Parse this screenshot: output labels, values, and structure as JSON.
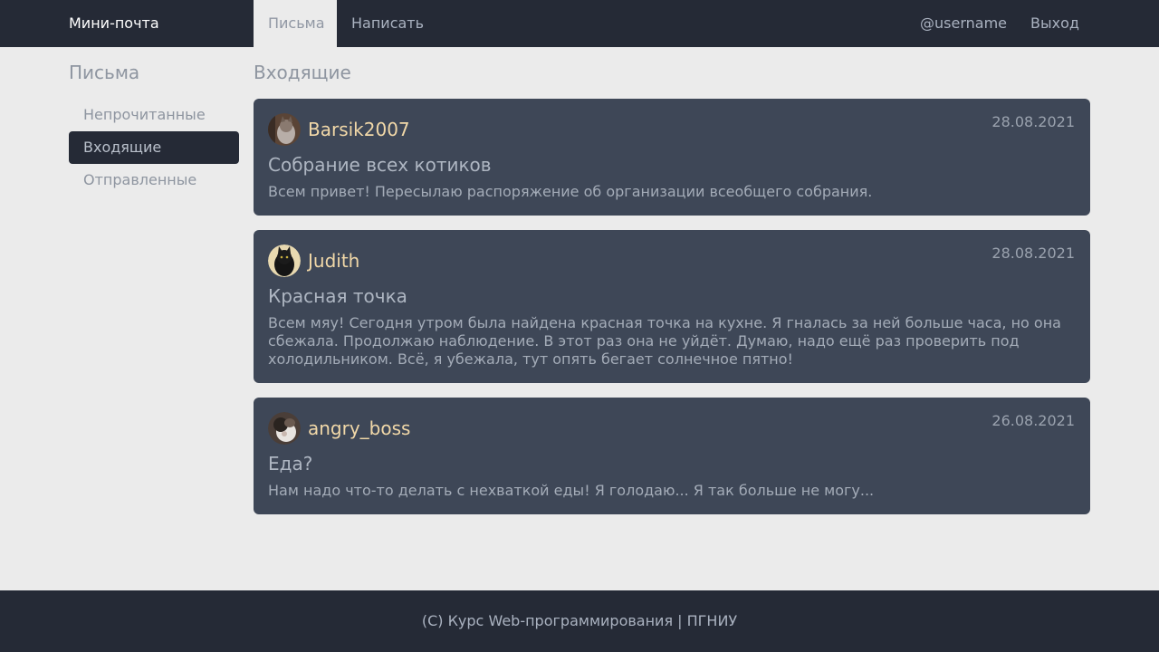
{
  "nav": {
    "brand": "Мини-почта",
    "letters": "Письма",
    "write": "Написать",
    "user": "@username",
    "logout": "Выход"
  },
  "sidebar": {
    "title": "Письма",
    "items": [
      {
        "label": "Непрочитанные"
      },
      {
        "label": "Входящие"
      },
      {
        "label": "Отправленные"
      }
    ]
  },
  "main": {
    "title": "Входящие",
    "messages": [
      {
        "sender": "Barsik2007",
        "date": "28.08.2021",
        "subject": "Собрание всех котиков",
        "preview": "Всем привет! Пересылаю распоряжение об организации всеобщего собрания."
      },
      {
        "sender": "Judith",
        "date": "28.08.2021",
        "subject": "Красная точка",
        "preview": "Всем мяу! Сегодня утром была найдена красная точка на кухне. Я гналась за ней больше часа, но она сбежала. Продолжаю наблюдение. В этот раз она не уйдёт. Думаю, надо ещё раз проверить под холодильником. Всё, я убежала, тут опять бегает солнечное пятно!"
      },
      {
        "sender": "angry_boss",
        "date": "26.08.2021",
        "subject": "Еда?",
        "preview": "Нам надо что-то делать с нехваткой еды! Я голодаю... Я так больше не могу..."
      }
    ]
  },
  "footer": {
    "text": "(C) Курс Web-программирования | ПГНИУ"
  }
}
